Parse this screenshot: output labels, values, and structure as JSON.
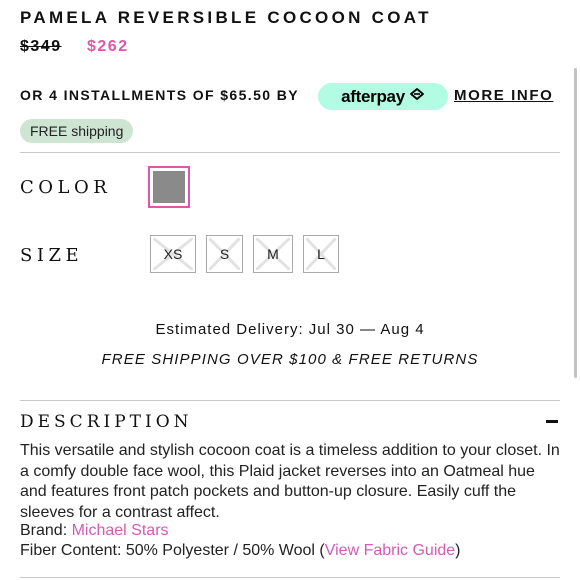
{
  "product": {
    "title": "PAMELA REVERSIBLE COCOON COAT",
    "price_original": "$349",
    "price_sale": "$262"
  },
  "installments": {
    "text": "OR 4 INSTALLMENTS OF $65.50 BY",
    "provider": "afterpay",
    "provider_color": "#b2fce4",
    "more_info": "MORE INFO"
  },
  "badge": {
    "free_shipping": "FREE shipping",
    "color": "#cfe5d3"
  },
  "color_section": {
    "label": "COLOR",
    "selected_swatch": "#8a8a8a",
    "selected_border": "#e056aa"
  },
  "size_section": {
    "label": "SIZE",
    "sizes": [
      "XS",
      "S",
      "M",
      "L"
    ]
  },
  "delivery": {
    "estimated": "Estimated Delivery: Jul 30 — Aug 4",
    "shipping_returns": "FREE SHIPPING OVER $100 & FREE RETURNS"
  },
  "description": {
    "title": "DESCRIPTION",
    "toggle_icon": "minus-icon",
    "body": "This versatile and stylish cocoon coat is a timeless addition to your closet. In a comfy double face wool, this Plaid jacket reverses into an Oatmeal hue and features front patch pockets and button-up closure. Easily cuff the sleeves for a contrast affect.",
    "brand_label": "Brand: ",
    "brand_name": "Michael Stars",
    "fiber_label": "Fiber Content: 50% Polyester / 50% Wool (",
    "fabric_guide": "View Fabric Guide",
    "fiber_close": ")"
  },
  "link_color": "#d35bb6"
}
